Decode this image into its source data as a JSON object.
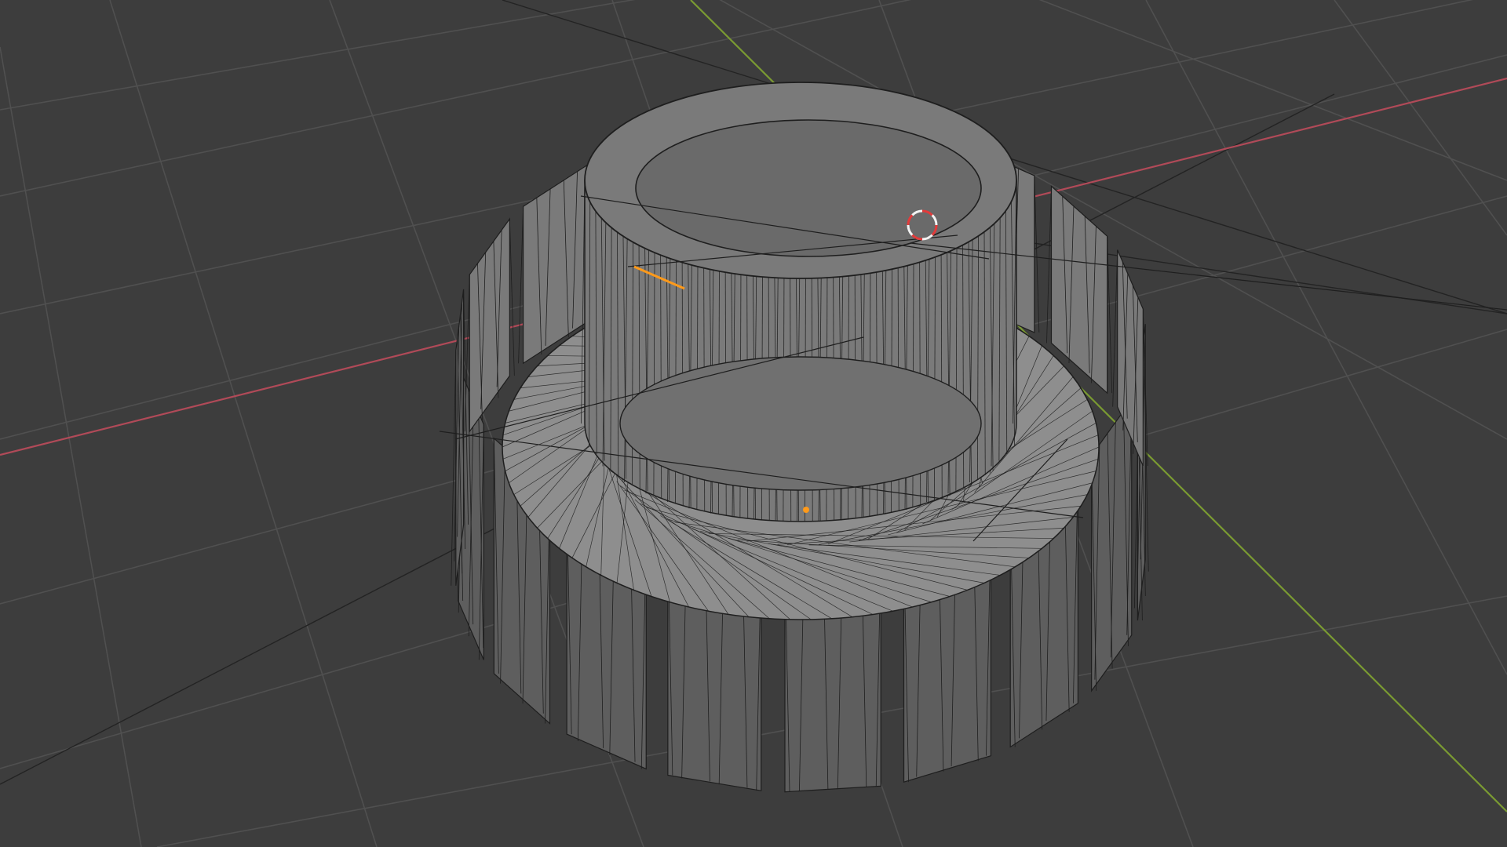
{
  "viewport": {
    "object": "gear-mesh",
    "display_mode": "wireframe-overlay"
  },
  "colors": {
    "background": "#3d3d3d",
    "grid": "#505050",
    "x_axis": "#b14a58",
    "y_axis": "#7a9a32",
    "mesh_fill": "#7a7a7a",
    "mesh_dark": "#5e5e5e",
    "mesh_light": "#8e8e8e",
    "wire": "#1e1e1e",
    "origin": "#ff9a1a",
    "cursor_red": "#e23b3b",
    "cursor_white": "#f2f2f2"
  },
  "gear": {
    "teeth": 18
  }
}
